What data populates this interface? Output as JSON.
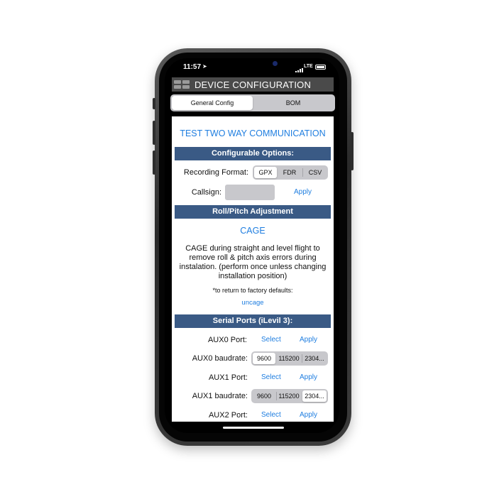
{
  "status": {
    "time": "11:57",
    "network": "LTE"
  },
  "header": {
    "title": "DEVICE CONFIGURATION"
  },
  "tabs": [
    {
      "label": "General Config",
      "selected": true
    },
    {
      "label": "BOM",
      "selected": false
    }
  ],
  "main": {
    "test_link": "TEST TWO WAY COMMUNICATION",
    "configurable": {
      "title": "Configurable Options:",
      "recording_format": {
        "label": "Recording Format:",
        "options": [
          "GPX",
          "FDR",
          "CSV"
        ],
        "selected": "GPX"
      },
      "callsign": {
        "label": "Callsign:",
        "value": "",
        "apply": "Apply"
      }
    },
    "roll_pitch": {
      "title": "Roll/Pitch Adjustment",
      "cage": "CAGE",
      "description": "CAGE during straight and level flight to remove roll & pitch axis errors during instalation. (perform once unless changing installation position)",
      "factory_note": "*to return to factory defaults:",
      "uncage": "uncage"
    },
    "serial_ports": {
      "title": "Serial Ports (iLevil 3):",
      "aux0_port": {
        "label": "AUX0 Port:",
        "select": "Select",
        "apply": "Apply"
      },
      "aux0_baud": {
        "label": "AUX0 baudrate:",
        "options": [
          "9600",
          "115200",
          "2304..."
        ],
        "selected": "9600"
      },
      "aux1_port": {
        "label": "AUX1 Port:",
        "select": "Select",
        "apply": "Apply"
      },
      "aux1_baud": {
        "label": "AUX1 baudrate:",
        "options": [
          "9600",
          "115200",
          "2304..."
        ],
        "selected": "2304..."
      },
      "aux2_port": {
        "label": "AUX2 Port:",
        "select": "Select",
        "apply": "Apply"
      }
    }
  },
  "colors": {
    "accent": "#1f7ee0",
    "section_bar": "#3a5a85",
    "header_bg": "#4a4a4a"
  },
  "icons": {
    "menu": "grid-menu-icon",
    "signal": "signal-icon",
    "battery": "battery-icon"
  }
}
